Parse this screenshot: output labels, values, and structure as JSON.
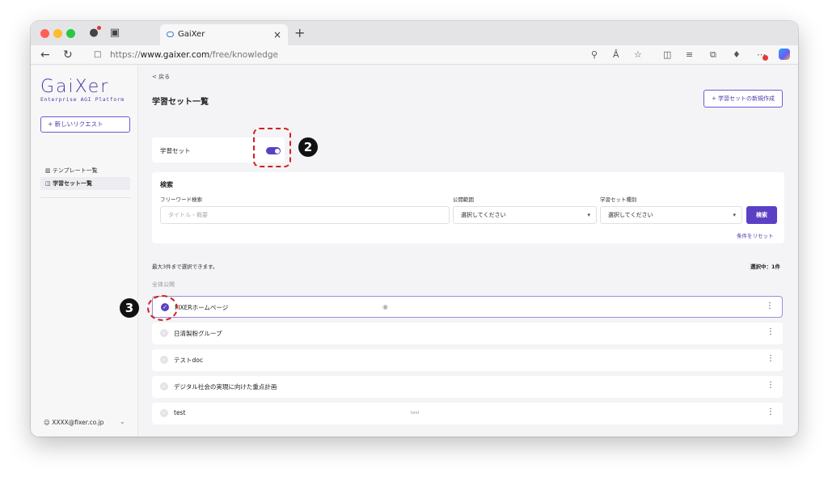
{
  "browser": {
    "tab_title": "GaiXer",
    "url_scheme": "https://",
    "url_host": "www.gaixer.com",
    "url_path": "/free/knowledge",
    "new_tab_glyph": "+",
    "close_glyph": "×"
  },
  "sidebar": {
    "logo": "GaiXer",
    "logo_subtitle": "Enterprise AGI Platform",
    "new_request_label": "+ 新しいリクエスト",
    "items": [
      {
        "label": "テンプレート一覧",
        "icon": "template-icon",
        "active": false
      },
      {
        "label": "学習セット一覧",
        "icon": "book-icon",
        "active": true
      }
    ],
    "user_email": "XXXX@fixer.co.jp"
  },
  "main": {
    "back_label": "< 戻る",
    "page_title": "学習セット一覧",
    "create_button_label": "+ 学習セットの新規作成",
    "toggle_card": {
      "label": "学習セット",
      "enabled": true
    },
    "search": {
      "title": "検索",
      "freeword_label": "フリーワード検索",
      "freeword_placeholder": "タイトル・概要",
      "visibility_label": "公開範囲",
      "visibility_value": "選択してください",
      "type_label": "学習セット種別",
      "type_value": "選択してください",
      "search_button": "検索",
      "reset_link": "条件をリセット"
    },
    "limit_text": "最大3件まで選択できます。",
    "selected_count": "選択中：1件",
    "group_label": "全体公開",
    "rows": [
      {
        "name": "FIXERホームページ",
        "selected": true,
        "desc": "",
        "globe": true
      },
      {
        "name": "日清製粉グループ",
        "selected": false,
        "desc": "",
        "globe": false
      },
      {
        "name": "テストdoc",
        "selected": false,
        "desc": "",
        "globe": false
      },
      {
        "name": "デジタル社会の実現に向けた重点計画",
        "selected": false,
        "desc": "",
        "globe": false
      },
      {
        "name": "test",
        "selected": false,
        "desc": "test",
        "globe": false
      }
    ]
  },
  "annotations": {
    "badge_2": "2",
    "badge_3": "3",
    "highlight_color": "#d42020"
  },
  "colors": {
    "accent": "#5b3fc4",
    "brand": "#4a3aa8"
  }
}
